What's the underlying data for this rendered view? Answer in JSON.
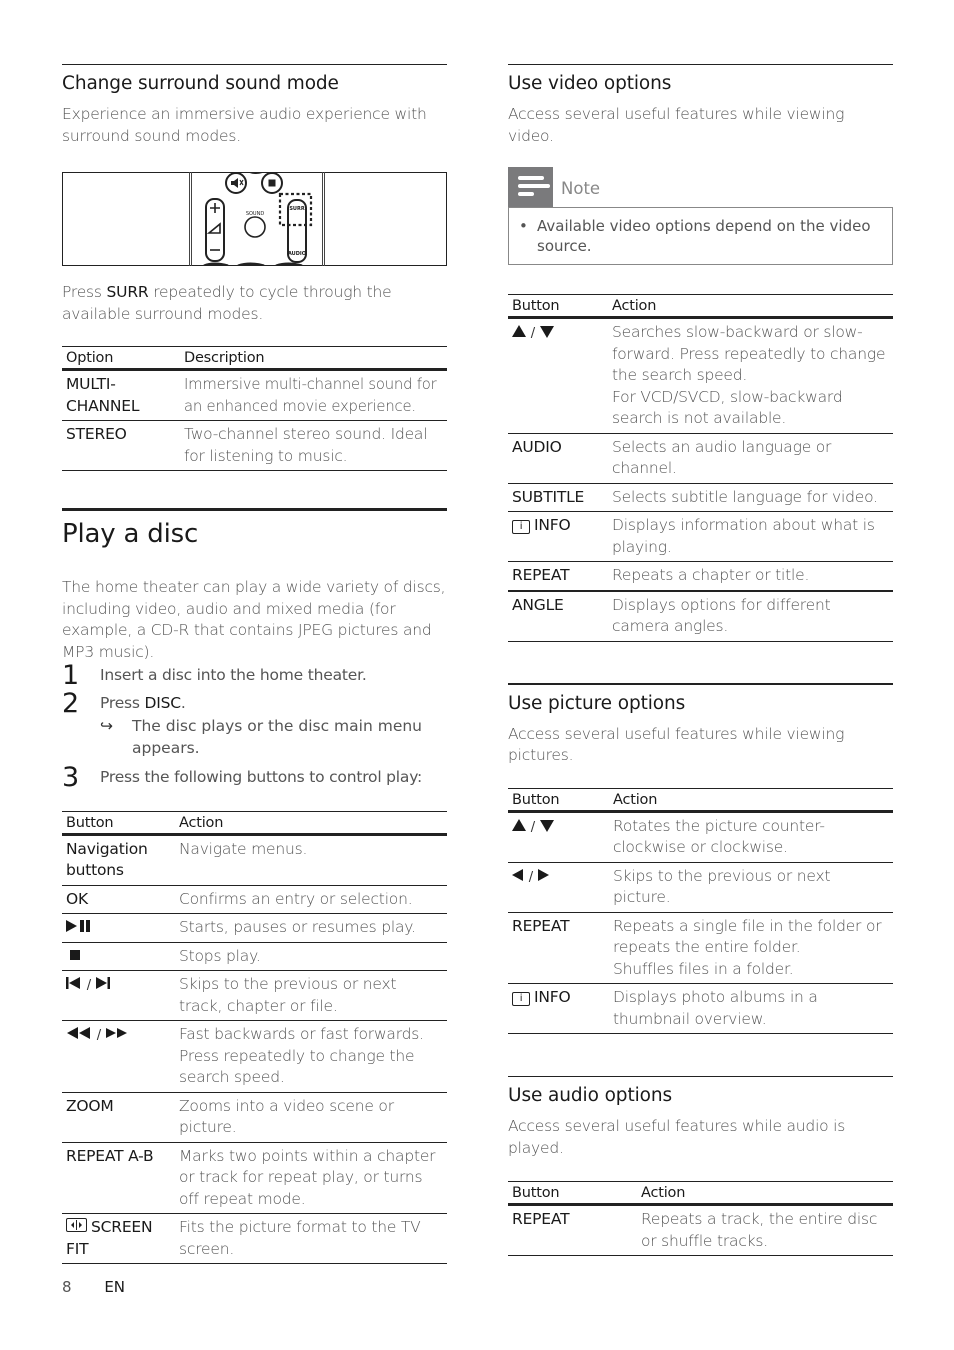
{
  "left": {
    "surround": {
      "title": "Change surround sound mode",
      "intro": "Experience an immersive audio experience with surround sound modes.",
      "figure": {
        "labels": {
          "sound": "SOUND",
          "surr": "SURR",
          "audio": "AUDIO"
        },
        "icons": [
          "mute-icon",
          "stop-icon",
          "volume-icon",
          "sound-button",
          "surr-button-highlight",
          "audio-button"
        ]
      },
      "press_prefix": "Press ",
      "press_key": "SURR",
      "press_suffix": " repeatedly to cycle through the available surround modes.",
      "table": {
        "headers": [
          "Option",
          "Description"
        ],
        "rows": [
          {
            "option": "MULTI-CHANNEL",
            "option_l1": "MULTI-",
            "option_l2": "CHANNEL",
            "description": "Immersive multi-channel sound for an enhanced movie experience."
          },
          {
            "option": "STEREO",
            "description": "Two-channel stereo sound. Ideal for listening to music."
          }
        ]
      }
    },
    "play": {
      "title": "Play a disc",
      "intro": "The home theater can play a wide variety of discs, including video, audio and mixed media (for example, a CD-R that contains JPEG pictures and MP3 music).",
      "steps": [
        {
          "num": "1",
          "text": "Insert a disc into the home theater."
        },
        {
          "num": "2",
          "text_prefix": "Press ",
          "key": "DISC",
          "text_suffix": ".",
          "result": "The disc plays or the disc main menu appears."
        },
        {
          "num": "3",
          "text": "Press the following buttons to control play:"
        }
      ],
      "result_arrow": "↪",
      "table": {
        "headers": [
          "Button",
          "Action"
        ],
        "rows": [
          {
            "button": "Navigation buttons",
            "action": "Navigate menus."
          },
          {
            "button": "OK",
            "action": "Confirms an entry or selection."
          },
          {
            "button_icon": "play-pause-icon",
            "action": "Starts, pauses or resumes play."
          },
          {
            "button_icon": "stop-icon",
            "action": "Stops play."
          },
          {
            "button_icon": "previous-next-icon",
            "separator": "/",
            "action": "Skips to the previous or next track, chapter or file."
          },
          {
            "button_icon": "rewind-fastforward-icon",
            "separator": "/",
            "action": "Fast backwards or fast forwards. Press repeatedly to change the search speed."
          },
          {
            "button": "ZOOM",
            "action": "Zooms into a video scene or picture."
          },
          {
            "button": "REPEAT A-B",
            "action": "Marks two points within a chapter or track for repeat play, or turns off repeat mode."
          },
          {
            "button": "SCREEN FIT",
            "button_icon": "screen-fit-icon",
            "action": "Fits the picture format to the TV screen."
          }
        ]
      }
    }
  },
  "right": {
    "video": {
      "title": "Use video options",
      "intro": "Access several useful features while viewing video.",
      "note": {
        "title": "Note",
        "bullet": "•",
        "text": "Available video options depend on the video source."
      },
      "table": {
        "headers": [
          "Button",
          "Action"
        ],
        "rows": [
          {
            "button_icon": "up-down-icon",
            "separator": "/",
            "action": "Searches slow-backward or slow-forward. Press repeatedly to change the search speed.",
            "action2": "For VCD/SVCD, slow-backward search is not available."
          },
          {
            "button": "AUDIO",
            "action": "Selects an audio language or channel."
          },
          {
            "button": "SUBTITLE",
            "action": "Selects subtitle language for video."
          },
          {
            "button": "INFO",
            "button_icon": "info-icon",
            "action": "Displays information about what is playing."
          },
          {
            "button": "REPEAT",
            "action": "Repeats a chapter or title."
          },
          {
            "button": "ANGLE",
            "action": "Displays options for different camera angles."
          }
        ]
      }
    },
    "picture": {
      "title": "Use picture options",
      "intro": "Access several useful features while viewing pictures.",
      "table": {
        "headers": [
          "Button",
          "Action"
        ],
        "rows": [
          {
            "button_icon": "up-down-icon",
            "separator": "/",
            "action": "Rotates the picture counter-clockwise or clockwise."
          },
          {
            "button_icon": "left-right-icon",
            "separator": "/",
            "action": "Skips to the previous or next picture."
          },
          {
            "button": "REPEAT",
            "action": "Repeats a single file in the folder or repeats the entire folder.",
            "action2": "Shuffles files in a folder."
          },
          {
            "button": "INFO",
            "button_icon": "info-icon",
            "action": "Displays photo albums in a thumbnail overview."
          }
        ]
      }
    },
    "audio": {
      "title": "Use audio options",
      "intro": "Access several useful features while audio is played.",
      "table": {
        "headers": [
          "Button",
          "Action"
        ],
        "rows": [
          {
            "button": "REPEAT",
            "action": "Repeats a track, the entire disc or shuffle tracks."
          }
        ]
      }
    }
  },
  "footer": {
    "page_number": "8",
    "language": "EN"
  }
}
